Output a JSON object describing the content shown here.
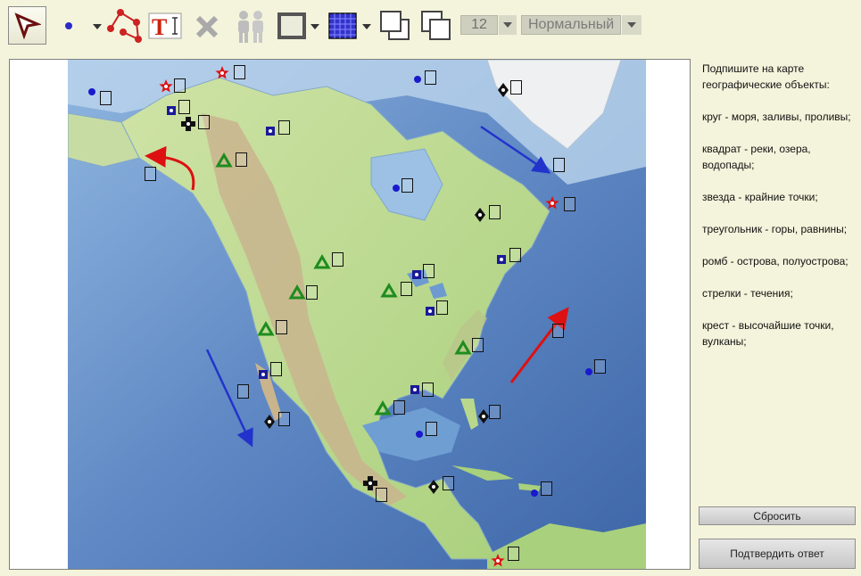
{
  "toolbar": {
    "tools": [
      {
        "name": "select-tool",
        "icon": "select-arrow-icon"
      },
      {
        "name": "point-tool",
        "icon": "point-icon"
      },
      {
        "name": "polyline-tool",
        "icon": "polyline-icon"
      },
      {
        "name": "text-tool",
        "icon": "text-icon"
      },
      {
        "name": "delete-tool",
        "icon": "delete-x-icon"
      },
      {
        "name": "users-tool",
        "icon": "users-icon"
      },
      {
        "name": "rectangle-tool",
        "icon": "rectangle-icon"
      },
      {
        "name": "grid-tool",
        "icon": "grid-icon"
      },
      {
        "name": "bring-front-tool",
        "icon": "bring-to-front-icon"
      },
      {
        "name": "send-back-tool",
        "icon": "send-to-back-icon"
      }
    ],
    "font_size": "12",
    "font_style": "Нормальный"
  },
  "instructions": {
    "intro": "Подпишите на карте географические объекты:",
    "legend": [
      "круг - моря, заливы, проливы;",
      "квадрат - реки, озера, водопады;",
      "звезда - крайние точки;",
      "треугольник - горы, равнины;",
      "ромб - острова, полуострова;",
      "стрелки - течения;",
      "крест - высочайшие точки, вулканы;"
    ]
  },
  "buttons": {
    "reset": "Сбросить",
    "submit": "Подтвердить ответ"
  },
  "map": {
    "marker_types": [
      "circle",
      "square",
      "star",
      "triangle",
      "diamond",
      "cross",
      "arrow"
    ],
    "colors": {
      "circle": "#1a1acc",
      "square": "#1a1a99",
      "star": "#dd1111",
      "triangle": "#1e8c1e",
      "diamond": "#111111",
      "cross": "#111111",
      "arrow_blue": "#2233cc",
      "arrow_red": "#dd1111"
    }
  }
}
